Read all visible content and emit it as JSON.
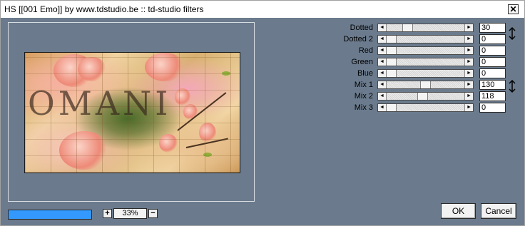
{
  "window": {
    "title": "HS [[001 Emo]] by www.tdstudio.be :: td-studio filters",
    "close_label": "✕"
  },
  "preview": {
    "watermark_text": "OMANI"
  },
  "progress": {
    "value": 1.0,
    "color": "#3399ff"
  },
  "zoom": {
    "value": "33%",
    "plus_label": "+",
    "minus_label": "−"
  },
  "params": [
    {
      "label": "Dotted",
      "value": "30",
      "fraction": 0.24
    },
    {
      "label": "Dotted 2",
      "value": "0",
      "fraction": 0.0
    },
    {
      "label": "Red",
      "value": "0",
      "fraction": 0.0
    },
    {
      "label": "Green",
      "value": "0",
      "fraction": 0.0
    },
    {
      "label": "Blue",
      "value": "0",
      "fraction": 0.0
    },
    {
      "label": "Mix 1",
      "value": "130",
      "fraction": 0.51
    },
    {
      "label": "Mix 2",
      "value": "118",
      "fraction": 0.46
    },
    {
      "label": "Mix 3",
      "value": "0",
      "fraction": 0.0
    }
  ],
  "buttons": {
    "ok_label": "OK",
    "cancel_label": "Cancel"
  },
  "icons": {
    "slider_left": "◄",
    "slider_right": "►",
    "link_pair": "link-arrows-icon"
  }
}
